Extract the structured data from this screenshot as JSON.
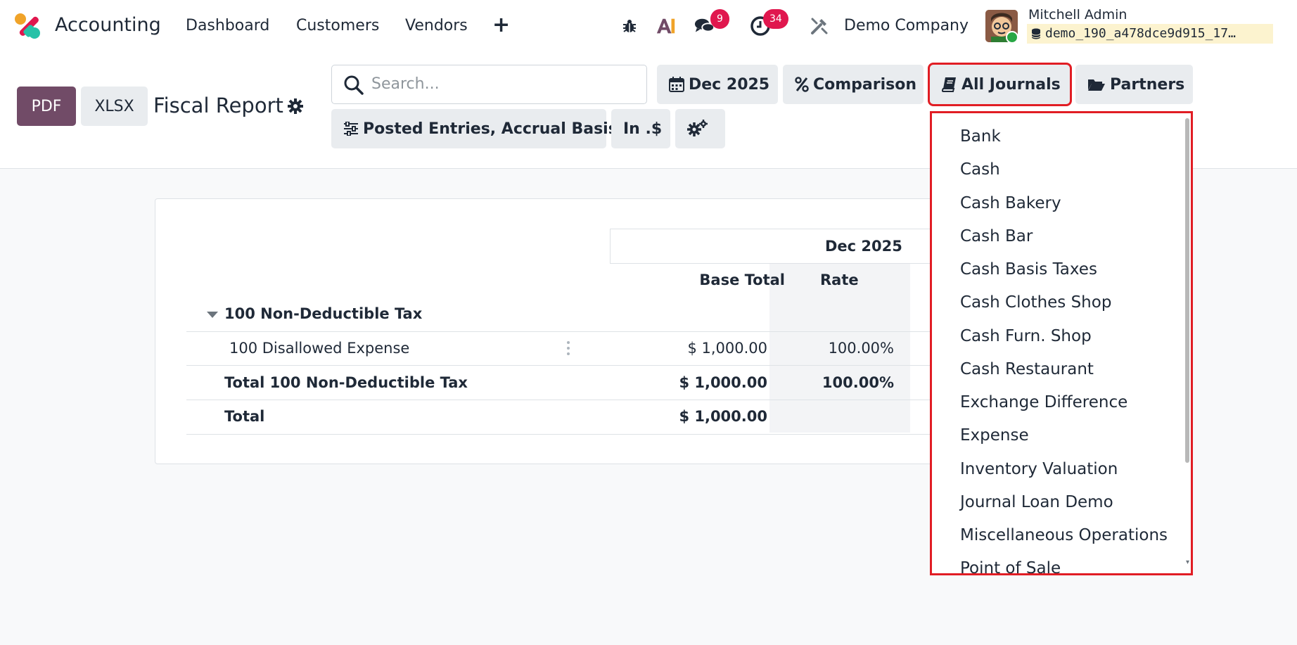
{
  "navbar": {
    "app_title": "Accounting",
    "menu": [
      "Dashboard",
      "Customers",
      "Vendors"
    ],
    "chat_badge": "9",
    "activity_badge": "34",
    "company": "Demo Company",
    "user_name": "Mitchell Admin",
    "database": "demo_190_a478dce9d915_17…",
    "brand_color": "#714b67"
  },
  "control": {
    "pdf_label": "PDF",
    "xlsx_label": "XLSX",
    "report_title": "Fiscal Report",
    "search_placeholder": "Search...",
    "filters": {
      "date": "Dec 2025",
      "comparison": "Comparison",
      "journals": "All Journals",
      "partners": "Partners",
      "entries": "Posted Entries, Accrual Basis",
      "currency": "In .$"
    }
  },
  "report": {
    "period": "Dec 2025",
    "columns": [
      "Base Total",
      "Rate"
    ],
    "group_label": "100 Non-Deductible Tax",
    "rows": [
      {
        "label": "100 Disallowed Expense",
        "base_total": "$ 1,000.00",
        "rate": "100.00%"
      },
      {
        "label": "Total 100 Non-Deductible Tax",
        "base_total": "$ 1,000.00",
        "rate": "100.00%"
      },
      {
        "label": "Total",
        "base_total": "$ 1,000.00",
        "rate": ""
      }
    ]
  },
  "journals_dropdown": [
    "Bank",
    "Cash",
    "Cash Bakery",
    "Cash Bar",
    "Cash Basis Taxes",
    "Cash Clothes Shop",
    "Cash Furn. Shop",
    "Cash Restaurant",
    "Exchange Difference",
    "Expense",
    "Inventory Valuation",
    "Journal Loan Demo",
    "Miscellaneous Operations",
    "Point of Sale"
  ]
}
